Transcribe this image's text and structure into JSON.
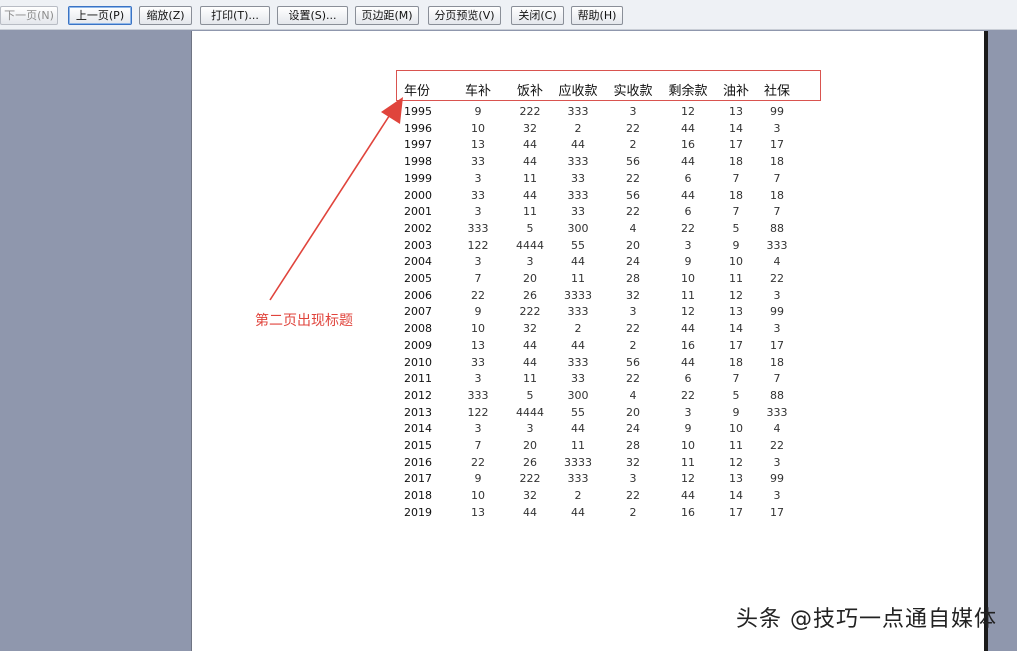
{
  "toolbar": {
    "buttons": [
      {
        "name": "next-page-button",
        "label": "下一页(N)",
        "disabled": true
      },
      {
        "name": "prev-page-button",
        "label": "上一页(P)",
        "focused": true
      },
      {
        "name": "zoom-button",
        "label": "缩放(Z)"
      },
      {
        "name": "print-button",
        "label": "打印(T)..."
      },
      {
        "name": "setup-button",
        "label": "设置(S)..."
      },
      {
        "name": "margins-button",
        "label": "页边距(M)"
      },
      {
        "name": "page-break-preview-button",
        "label": "分页预览(V)"
      },
      {
        "name": "close-button",
        "label": "关闭(C)"
      },
      {
        "name": "help-button",
        "label": "帮助(H)"
      }
    ]
  },
  "table": {
    "headers": [
      "年份",
      "车补",
      "饭补",
      "应收款",
      "实收款",
      "剩余款",
      "油补",
      "社保"
    ],
    "rows": [
      [
        "1995",
        "9",
        "222",
        "333",
        "3",
        "12",
        "13",
        "99"
      ],
      [
        "1996",
        "10",
        "32",
        "2",
        "22",
        "44",
        "14",
        "3"
      ],
      [
        "1997",
        "13",
        "44",
        "44",
        "2",
        "16",
        "17",
        "17"
      ],
      [
        "1998",
        "33",
        "44",
        "333",
        "56",
        "44",
        "18",
        "18"
      ],
      [
        "1999",
        "3",
        "11",
        "33",
        "22",
        "6",
        "7",
        "7"
      ],
      [
        "2000",
        "33",
        "44",
        "333",
        "56",
        "44",
        "18",
        "18"
      ],
      [
        "2001",
        "3",
        "11",
        "33",
        "22",
        "6",
        "7",
        "7"
      ],
      [
        "2002",
        "333",
        "5",
        "300",
        "4",
        "22",
        "5",
        "88"
      ],
      [
        "2003",
        "122",
        "4444",
        "55",
        "20",
        "3",
        "9",
        "333"
      ],
      [
        "2004",
        "3",
        "3",
        "44",
        "24",
        "9",
        "10",
        "4"
      ],
      [
        "2005",
        "7",
        "20",
        "11",
        "28",
        "10",
        "11",
        "22"
      ],
      [
        "2006",
        "22",
        "26",
        "3333",
        "32",
        "11",
        "12",
        "3"
      ],
      [
        "2007",
        "9",
        "222",
        "333",
        "3",
        "12",
        "13",
        "99"
      ],
      [
        "2008",
        "10",
        "32",
        "2",
        "22",
        "44",
        "14",
        "3"
      ],
      [
        "2009",
        "13",
        "44",
        "44",
        "2",
        "16",
        "17",
        "17"
      ],
      [
        "2010",
        "33",
        "44",
        "333",
        "56",
        "44",
        "18",
        "18"
      ],
      [
        "2011",
        "3",
        "11",
        "33",
        "22",
        "6",
        "7",
        "7"
      ],
      [
        "2012",
        "333",
        "5",
        "300",
        "4",
        "22",
        "5",
        "88"
      ],
      [
        "2013",
        "122",
        "4444",
        "55",
        "20",
        "3",
        "9",
        "333"
      ],
      [
        "2014",
        "3",
        "3",
        "44",
        "24",
        "9",
        "10",
        "4"
      ],
      [
        "2015",
        "7",
        "20",
        "11",
        "28",
        "10",
        "11",
        "22"
      ],
      [
        "2016",
        "22",
        "26",
        "3333",
        "32",
        "11",
        "12",
        "3"
      ],
      [
        "2017",
        "9",
        "222",
        "333",
        "3",
        "12",
        "13",
        "99"
      ],
      [
        "2018",
        "10",
        "32",
        "2",
        "22",
        "44",
        "14",
        "3"
      ],
      [
        "2019",
        "13",
        "44",
        "44",
        "2",
        "16",
        "17",
        "17"
      ]
    ]
  },
  "annotation": {
    "text": "第二页出现标题",
    "color": "#e0443c"
  },
  "watermark": {
    "text": "头条 @技巧一点通自媒体"
  }
}
